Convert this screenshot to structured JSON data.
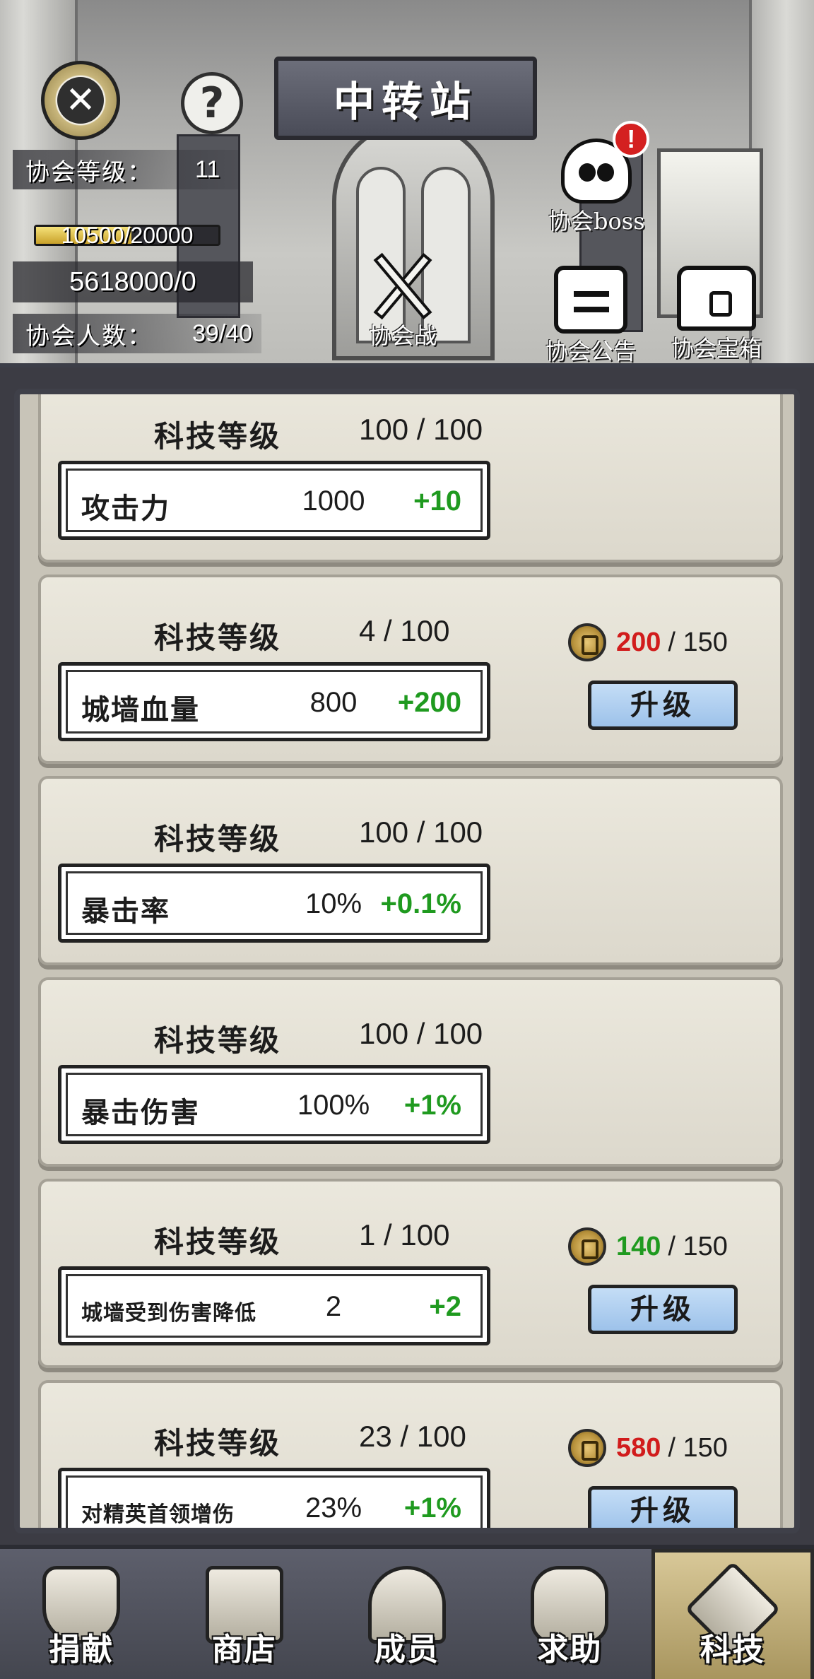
{
  "header": {
    "title": "中转站",
    "guild_level_label": "协会等级：",
    "guild_level": "11",
    "exp_text": "10500/20000",
    "exp_fraction": 0.525,
    "funds_text": "5618000/0",
    "members_label": "协会人数：",
    "members_value": "39/40",
    "icons": {
      "guild_war": "协会战",
      "guild_boss": "协会boss",
      "guild_notice": "协会公告",
      "guild_chest": "协会宝箱",
      "boss_alert": "!"
    }
  },
  "cards": [
    {
      "level_label": "科技等级",
      "level": "100 / 100",
      "stat_name": "攻击力",
      "stat_current": "1000",
      "stat_gain": "+10",
      "upgradable": false
    },
    {
      "level_label": "科技等级",
      "level": "4 / 100",
      "stat_name": "城墙血量",
      "stat_current": "800",
      "stat_gain": "+200",
      "upgradable": true,
      "cost_have": "200",
      "cost_need": "/ 150",
      "cost_color": "#d11c1c",
      "upgrade_label": "升级"
    },
    {
      "level_label": "科技等级",
      "level": "100 / 100",
      "stat_name": "暴击率",
      "stat_current": "10%",
      "stat_gain": "+0.1%",
      "upgradable": false
    },
    {
      "level_label": "科技等级",
      "level": "100 / 100",
      "stat_name": "暴击伤害",
      "stat_current": "100%",
      "stat_gain": "+1%",
      "upgradable": false
    },
    {
      "level_label": "科技等级",
      "level": "1 / 100",
      "stat_name": "城墙受到伤害降低",
      "stat_current": "2",
      "stat_gain": "+2",
      "upgradable": true,
      "cost_have": "140",
      "cost_need": "/ 150",
      "cost_color": "#1f9a1f",
      "upgrade_label": "升级"
    },
    {
      "level_label": "科技等级",
      "level": "23 / 100",
      "stat_name": "对精英首领增伤",
      "stat_current": "23%",
      "stat_gain": "+1%",
      "upgradable": true,
      "cost_have": "580",
      "cost_need": "/ 150",
      "cost_color": "#d11c1c",
      "upgrade_label": "升级"
    }
  ],
  "nav": {
    "tabs": [
      "捐献",
      "商店",
      "成员",
      "求助",
      "科技"
    ],
    "active_index": 4
  },
  "colors": {
    "gain_green": "#1f9a1f",
    "upgrade_button": "#a9cbef",
    "active_tab": "#c9b882"
  }
}
